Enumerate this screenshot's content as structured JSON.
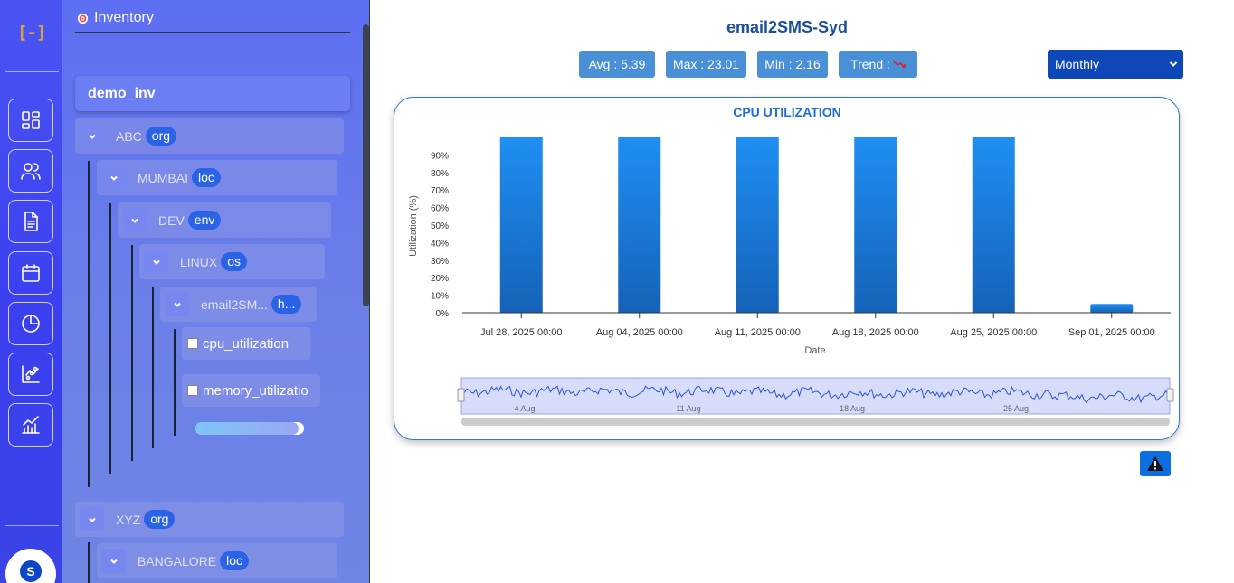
{
  "rail": {
    "logo": "[-]",
    "items": [
      "dashboard-icon",
      "users-icon",
      "document-icon",
      "calendar-icon",
      "pie-chart-icon",
      "scatter-chart-icon",
      "line-chart-icon"
    ],
    "avatar_letter": "S"
  },
  "tree": {
    "header": "Inventory",
    "root": "demo_inv",
    "nodes": [
      {
        "label": "ABC",
        "badge": "org"
      },
      {
        "label": "MUMBAI",
        "badge": "loc"
      },
      {
        "label": "DEV",
        "badge": "env"
      },
      {
        "label": "LINUX",
        "badge": "os"
      },
      {
        "label": "email2SM...",
        "badge": "h..."
      },
      {
        "label": "XYZ",
        "badge": "org"
      },
      {
        "label": "BANGALORE",
        "badge": "loc"
      }
    ],
    "leaves": [
      "cpu_utilization",
      "memory_utilizatio"
    ],
    "loading_progress": 0.95
  },
  "main": {
    "title": "email2SMS-Syd",
    "stats": {
      "avg": "Avg : 5.39",
      "max": "Max : 23.01",
      "min": "Min : 2.16",
      "trend": "Trend : "
    },
    "period": "Monthly"
  },
  "chart_data": {
    "type": "bar",
    "title": "CPU UTILIZATION",
    "xlabel": "Date",
    "ylabel": "Utilization (%)",
    "categories": [
      "Jul 28, 2025 00:00",
      "Aug 04, 2025 00:00",
      "Aug 11, 2025 00:00",
      "Aug 18, 2025 00:00",
      "Aug 25, 2025 00:00",
      "Sep 01, 2025 00:00"
    ],
    "values": [
      100,
      100,
      100,
      100,
      100,
      5
    ],
    "yticks": [
      "0%",
      "10%",
      "20%",
      "30%",
      "40%",
      "50%",
      "60%",
      "70%",
      "80%",
      "90%"
    ],
    "ylim": [
      0,
      100
    ],
    "navigator_labels": [
      "4 Aug",
      "11 Aug",
      "18 Aug",
      "25 Aug"
    ],
    "colors": {
      "bar_top": "#1e8ff3",
      "bar_bottom": "#1662b8",
      "navigator": "#2a56d8"
    }
  }
}
